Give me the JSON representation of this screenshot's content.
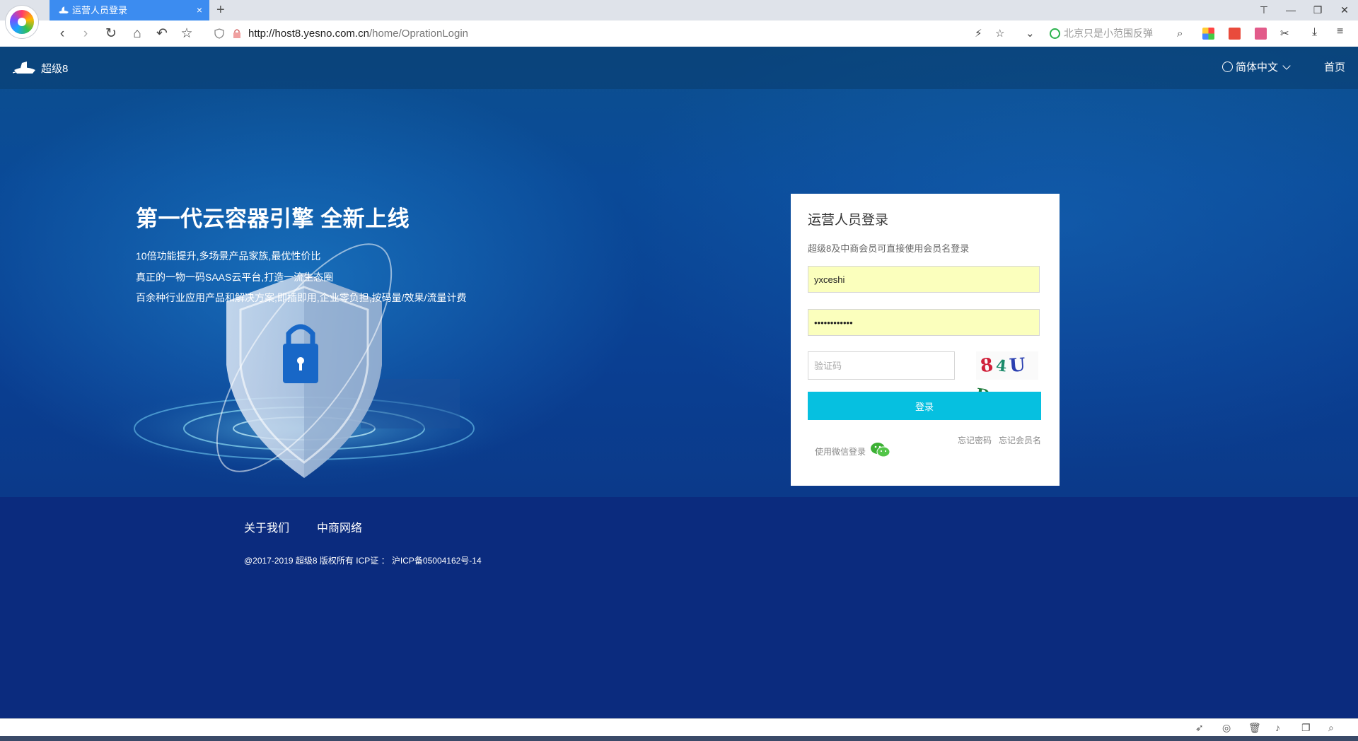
{
  "browser": {
    "tab_title": "运营人员登录",
    "tab_close": "×",
    "new_tab": "+",
    "url_host": "http://host8.yesno.com.cn",
    "url_path": "/home/OprationLogin",
    "search_placeholder": "北京只是小范围反弹",
    "nav_icons": [
      "back-icon",
      "forward-icon",
      "reload-icon",
      "home-icon",
      "undo-icon",
      "star-icon"
    ],
    "window_buttons": [
      "⊤",
      "—",
      "❐",
      "✕"
    ]
  },
  "header": {
    "brand": "超级8",
    "language": "简体中文",
    "home": "首页"
  },
  "hero": {
    "title": "第一代云容器引擎 全新上线",
    "lines": [
      "10倍功能提升,多场景产品家族,最优性价比",
      "真正的一物一码SAAS云平台,打造一流生态圈",
      "百余种行业应用产品和解决方案,即插即用,企业零负担,按码量/效果/流量计费"
    ]
  },
  "login": {
    "title": "运营人员登录",
    "subtitle": "超级8及中商会员可直接使用会员名登录",
    "username_value": "yxceshi",
    "password_value": "••••••••••••",
    "captcha_placeholder": "验证码",
    "captcha_chars": [
      "8",
      "4",
      "U",
      "D"
    ],
    "login_button": "登录",
    "forgot_password": "忘记密码",
    "forgot_username": "忘记会员名",
    "wechat_login": "使用微信登录"
  },
  "footer": {
    "about": "关于我们",
    "network": "中商网络",
    "copyright": "@2017-2019 超级8 版权所有 ICP证 ： 沪ICP备05004162号-14"
  },
  "colors": {
    "login_button": "#06c0e0",
    "autofill": "#fbffbd",
    "footer_bg": "#0b2b7e",
    "tab_active": "#3c8cf0"
  }
}
